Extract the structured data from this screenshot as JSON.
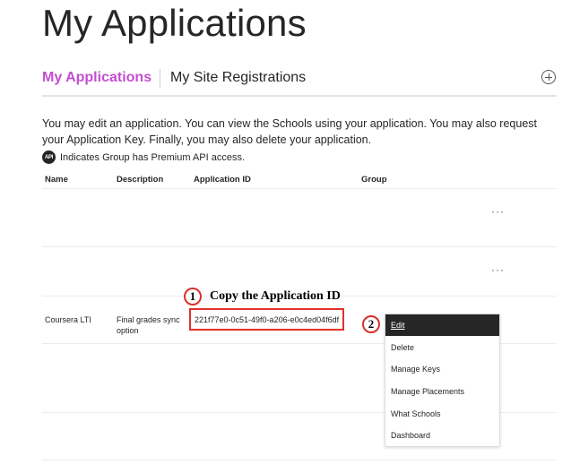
{
  "page": {
    "title": "My Applications"
  },
  "tabs": [
    {
      "label": "My Applications",
      "active": true
    },
    {
      "label": "My Site Registrations",
      "active": false
    }
  ],
  "add_icon": "plus-circle-icon",
  "intro": {
    "text": "You may edit an application. You can view the Schools using your application. You may also request your Application Key. Finally, you may also delete your application.",
    "premium_badge": "API",
    "premium_note": "Indicates Group has Premium API access."
  },
  "table": {
    "headers": [
      "Name",
      "Description",
      "Application ID",
      "Group"
    ],
    "rows": [
      {
        "name": "",
        "description": "",
        "application_id": "",
        "group": "",
        "actions": "···"
      },
      {
        "name": "",
        "description": "",
        "application_id": "",
        "group": "",
        "actions": "···"
      },
      {
        "name": "Coursera LTI",
        "description_line1": "Final grades sync",
        "description_line2": "option",
        "application_id": "221f77e0-0c51-49f0-a206-e0c4ed04f6df",
        "group": ""
      }
    ]
  },
  "annotations": {
    "step1_number": "1",
    "step1_text": "Copy the Application ID",
    "step2_number": "2"
  },
  "context_menu": {
    "items": [
      "Edit",
      "Delete",
      "Manage Keys",
      "Manage Placements",
      "What Schools",
      "Dashboard"
    ],
    "active_index": 0
  },
  "colors": {
    "accent": "#c24fd0",
    "annotation_red": "#e1322b",
    "menu_active_bg": "#262626"
  }
}
